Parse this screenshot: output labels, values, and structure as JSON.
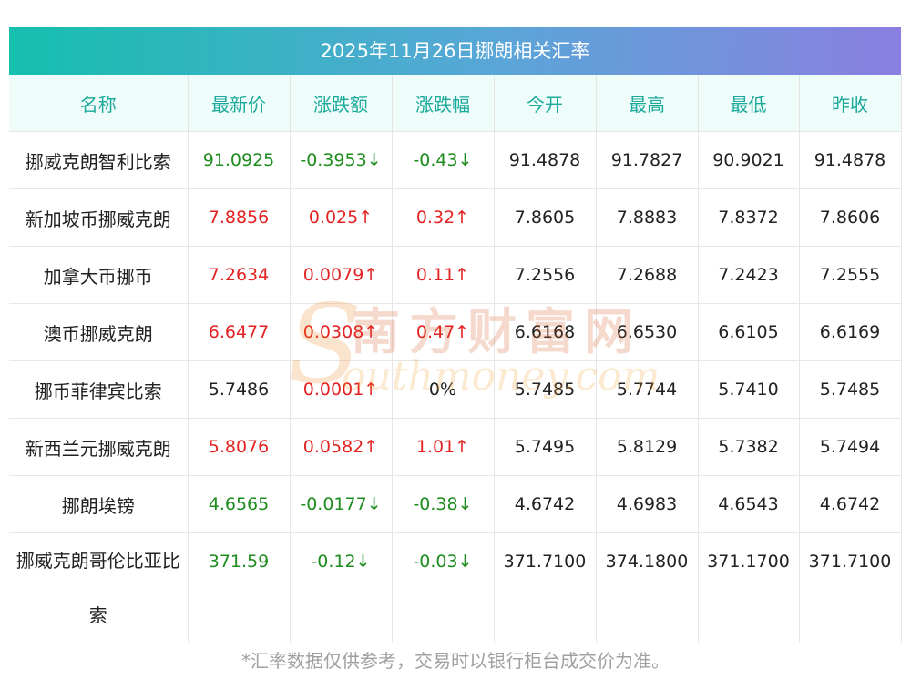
{
  "title": "2025年11月26日挪朗相关汇率",
  "headers": [
    "名称",
    "最新价",
    "涨跌额",
    "涨跌幅",
    "今开",
    "最高",
    "最低",
    "昨收"
  ],
  "rows": [
    {
      "name": "挪威克朗智利比索",
      "latest": "91.0925",
      "change": "-0.3953↓",
      "pct": "-0.43↓",
      "open": "91.4878",
      "high": "91.7827",
      "low": "90.9021",
      "prev": "91.4878",
      "dir": "down"
    },
    {
      "name": "新加坡币挪威克朗",
      "latest": "7.8856",
      "change": "0.025↑",
      "pct": "0.32↑",
      "open": "7.8605",
      "high": "7.8883",
      "low": "7.8372",
      "prev": "7.8606",
      "dir": "up"
    },
    {
      "name": "加拿大币挪币",
      "latest": "7.2634",
      "change": "0.0079↑",
      "pct": "0.11↑",
      "open": "7.2556",
      "high": "7.2688",
      "low": "7.2423",
      "prev": "7.2555",
      "dir": "up"
    },
    {
      "name": "澳币挪威克朗",
      "latest": "6.6477",
      "change": "0.0308↑",
      "pct": "0.47↑",
      "open": "6.6168",
      "high": "6.6530",
      "low": "6.6105",
      "prev": "6.6169",
      "dir": "up"
    },
    {
      "name": "挪币菲律宾比索",
      "latest": "5.7486",
      "change": "0.0001↑",
      "pct": "0%",
      "open": "5.7485",
      "high": "5.7744",
      "low": "5.7410",
      "prev": "5.7485",
      "dir": "flat-up"
    },
    {
      "name": "新西兰元挪威克朗",
      "latest": "5.8076",
      "change": "0.0582↑",
      "pct": "1.01↑",
      "open": "5.7495",
      "high": "5.8129",
      "low": "5.7382",
      "prev": "5.7494",
      "dir": "up"
    },
    {
      "name": "挪朗埃镑",
      "latest": "4.6565",
      "change": "-0.0177↓",
      "pct": "-0.38↓",
      "open": "4.6742",
      "high": "4.6983",
      "low": "4.6543",
      "prev": "4.6742",
      "dir": "down"
    },
    {
      "name": "挪威克朗哥伦比亚比索",
      "latest": "371.59",
      "change": "-0.12↓",
      "pct": "-0.03↓",
      "open": "371.7100",
      "high": "374.1800",
      "low": "371.1700",
      "prev": "371.7100",
      "dir": "down"
    }
  ],
  "footnote": "*汇率数据仅供参考，交易时以银行柜台成交价为准。",
  "watermark": {
    "cn": "南方财富网",
    "en": "outhmoney.com",
    "s": "S"
  },
  "colors": {
    "up": "#e42222",
    "down": "#1e8c1e",
    "header_text": "#1aa99a",
    "title_start": "#16bfae",
    "title_end": "#8a7fe0"
  }
}
